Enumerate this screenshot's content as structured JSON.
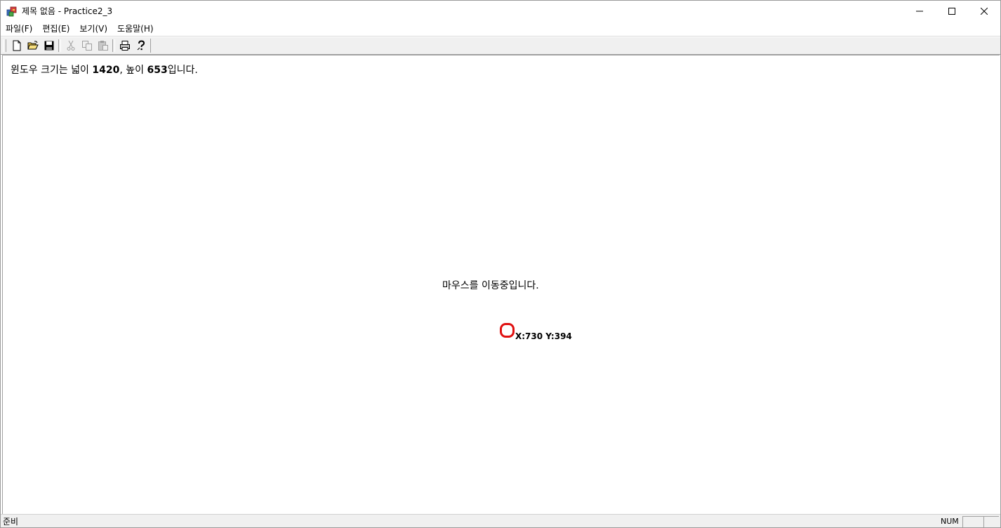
{
  "window": {
    "title": "제목 없음 - Practice2_3"
  },
  "menu": {
    "items": [
      "파일(F)",
      "편집(E)",
      "보기(V)",
      "도움말(H)"
    ]
  },
  "toolbar": {
    "buttons": [
      {
        "icon": "new-file-icon",
        "enabled": true
      },
      {
        "icon": "open-folder-icon",
        "enabled": true
      },
      {
        "icon": "save-icon",
        "enabled": true
      },
      {
        "icon": "cut-icon",
        "enabled": false
      },
      {
        "icon": "copy-icon",
        "enabled": false
      },
      {
        "icon": "paste-icon",
        "enabled": false
      },
      {
        "icon": "print-icon",
        "enabled": true
      },
      {
        "icon": "help-icon",
        "enabled": true
      }
    ]
  },
  "client": {
    "size_prefix": "윈도우 크기는 넓이 ",
    "width_value": "1420",
    "size_middle": ", 높이 ",
    "height_value": "653",
    "size_suffix": "입니다.",
    "move_message": "마우스를 이동중입니다.",
    "coord_text": "X:730 Y:394",
    "marker_color": "#e01010"
  },
  "status": {
    "ready": "준비",
    "num": "NUM"
  }
}
